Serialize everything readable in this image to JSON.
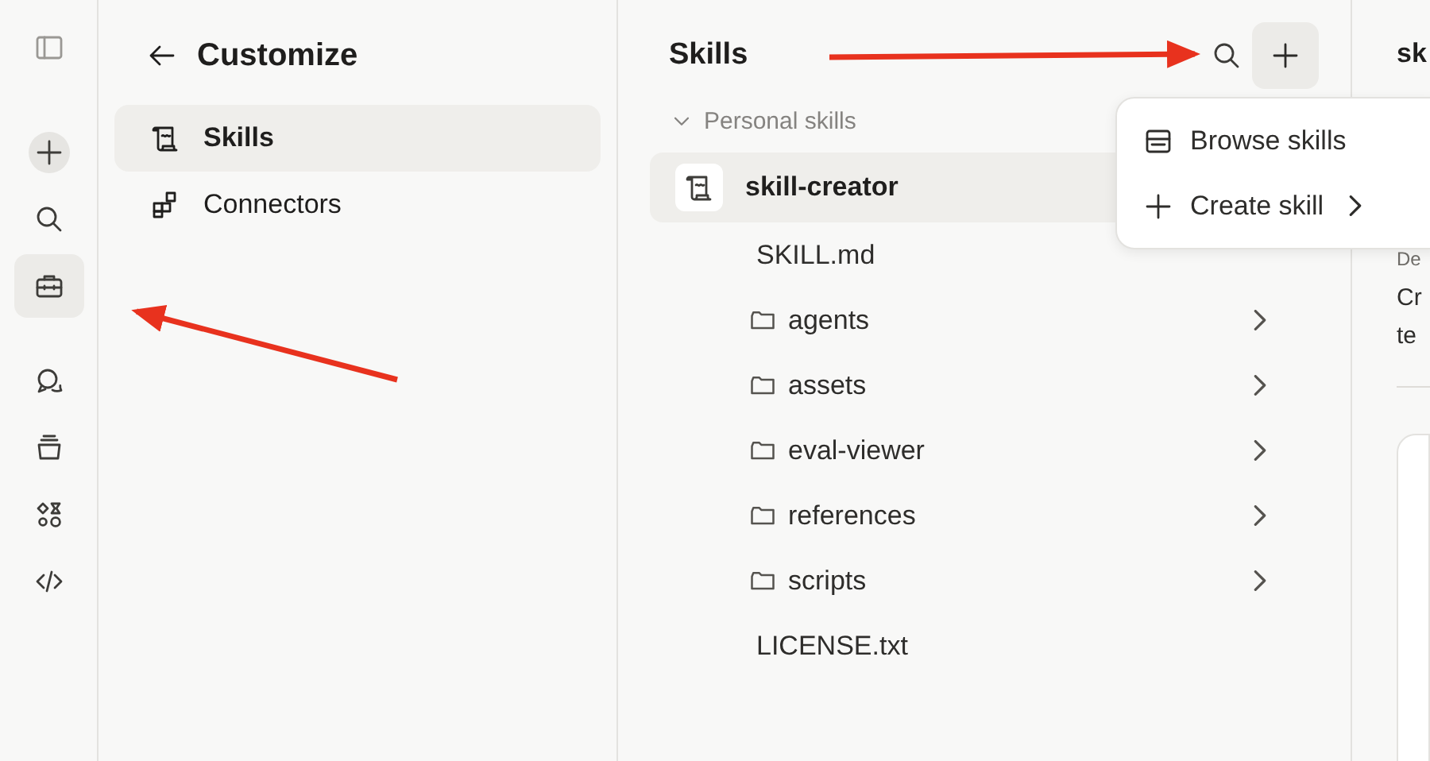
{
  "rail": {
    "items": [
      {
        "selected": false
      },
      {
        "selected": false
      },
      {
        "selected": true
      },
      {
        "selected": false
      },
      {
        "selected": false
      },
      {
        "selected": false
      },
      {
        "selected": false
      }
    ]
  },
  "customize": {
    "title": "Customize",
    "items": [
      {
        "label": "Skills",
        "selected": true
      },
      {
        "label": "Connectors",
        "selected": false
      }
    ]
  },
  "skills": {
    "title": "Skills",
    "section": {
      "label": "Personal skills",
      "expanded": true
    },
    "tree": [
      {
        "name": "skill-creator",
        "kind": "skill",
        "selected": true,
        "children": [
          {
            "name": "SKILL.md",
            "kind": "file"
          },
          {
            "name": "agents",
            "kind": "folder",
            "expanded": false
          },
          {
            "name": "assets",
            "kind": "folder",
            "expanded": false
          },
          {
            "name": "eval-viewer",
            "kind": "folder",
            "expanded": false
          },
          {
            "name": "references",
            "kind": "folder",
            "expanded": false
          },
          {
            "name": "scripts",
            "kind": "folder",
            "expanded": false
          },
          {
            "name": "LICENSE.txt",
            "kind": "file"
          }
        ]
      }
    ]
  },
  "menu": {
    "items": [
      {
        "label": "Browse skills",
        "submenu": false
      },
      {
        "label": "Create skill",
        "submenu": true
      }
    ]
  },
  "detail": {
    "title": "sk",
    "label": "De",
    "description": [
      "Cr",
      "te"
    ]
  }
}
